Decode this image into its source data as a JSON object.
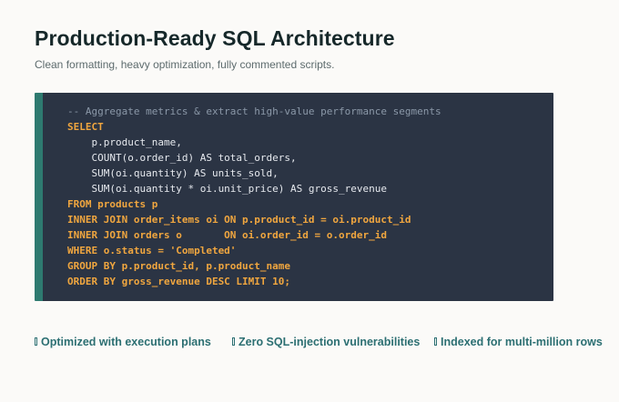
{
  "header": {
    "title": "Production-Ready SQL Architecture",
    "subtitle": "Clean formatting, heavy optimization, fully commented scripts."
  },
  "code": {
    "language": "sql",
    "lines": [
      {
        "text": "-- Aggregate metrics & extract high-value performance segments",
        "kind": "comment"
      },
      {
        "text": "SELECT",
        "kind": "keyword"
      },
      {
        "text": "    p.product_name,",
        "kind": "plain"
      },
      {
        "text": "    COUNT(o.order_id) AS total_orders,",
        "kind": "plain"
      },
      {
        "text": "    SUM(oi.quantity) AS units_sold,",
        "kind": "plain"
      },
      {
        "text": "    SUM(oi.quantity * oi.unit_price) AS gross_revenue",
        "kind": "plain"
      },
      {
        "text": "FROM products p",
        "kind": "keyword"
      },
      {
        "text": "INNER JOIN order_items oi ON p.product_id = oi.product_id",
        "kind": "keyword"
      },
      {
        "text": "INNER JOIN orders o       ON oi.order_id = o.order_id",
        "kind": "keyword"
      },
      {
        "text": "WHERE o.status = 'Completed'",
        "kind": "keyword"
      },
      {
        "text": "GROUP BY p.product_id, p.product_name",
        "kind": "keyword"
      },
      {
        "text": "ORDER BY gross_revenue DESC LIMIT 10;",
        "kind": "keyword"
      }
    ]
  },
  "features": [
    {
      "label": "Optimized with execution plans",
      "icon": "check-icon"
    },
    {
      "label": "Zero SQL-injection vulnerabilities",
      "icon": "check-icon"
    },
    {
      "label": "Indexed for multi-million rows",
      "icon": "check-icon"
    }
  ],
  "colors": {
    "background": "#fbfaf8",
    "title": "#16282a",
    "subtitle": "#5d6b6d",
    "code_background": "#2b3444",
    "code_accent": "#2e7a70",
    "keyword": "#f0a63f",
    "comment": "#8b98a8",
    "feature_text": "#2c6f72"
  }
}
